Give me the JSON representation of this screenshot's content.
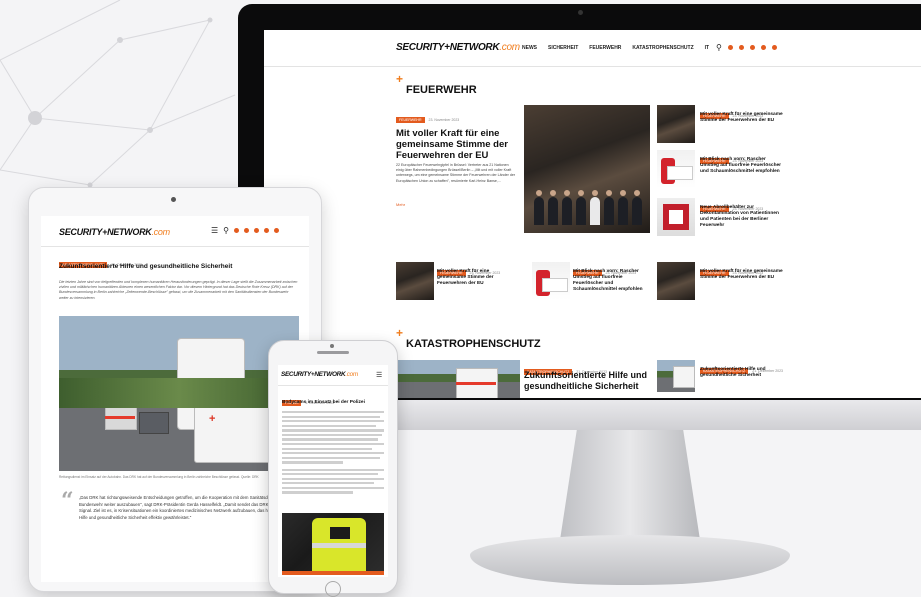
{
  "brand": {
    "logo_part1": "SECURITY",
    "logo_part2": "NETWORK",
    "logo_part3": ".com",
    "accent": "#e35b1e"
  },
  "desktop": {
    "nav": [
      "NEWS",
      "SICHERHEIT",
      "FEUERWEHR",
      "KATASTROPHENSCHUTZ",
      "IT"
    ],
    "feuerwehr": {
      "heading": "FEUERWEHR",
      "lead": {
        "category": "FEUERWEHR",
        "date": "23. November 2023",
        "title": "Mit voller Kraft für eine gemeinsame Stimme der Feuerwehren der EU",
        "text": "22 Europäischer Feuerwehrgipfel in Brüssel: Vertreter aus 21 Nationen einig über Rahmenbedingungen Brüssel/Berlin – „Mit und mit voller Kraft unterwegs, um eine gemeinsame Stimme der Feuerwehren der Länder der Europäischen Union zu schaffen\", resümierte Karl-Heinz Banse,...",
        "more": "Mehr"
      },
      "side": [
        {
          "category": "FEUERWEHR",
          "date": "23. November 2023",
          "title": "Mit voller Kraft für eine gemeinsame Stimme der Feuerwehren der EU"
        },
        {
          "category": "FEUERWEHR",
          "date": "23. November 2023",
          "title": "Mit Blick nach vorn: Rascher Umstieg auf fluorfreie Feuerlöscher und Schaumlöschmittel empfohlen"
        },
        {
          "category": "FEUERWEHR",
          "date": "23. November 2023",
          "title": "Neue Abrollbehälter zur Dekontamination von Patientinnen und Patienten bei der Berliner Feuerwehr"
        }
      ],
      "row": [
        {
          "category": "FEUERWEHR",
          "date": "23. November 2023",
          "title": "Mit voller Kraft für eine gemeinsame Stimme der Feuerwehren der EU"
        },
        {
          "category": "FEUERWEHR",
          "date": "23. November 2023",
          "title": "Mit Blick nach vorn: Rascher Umstieg auf fluorfreie Feuerlöscher und Schaumlöschmittel empfohlen"
        },
        {
          "category": "FEUERWEHR",
          "date": "23. November 2023",
          "title": "Mit voller Kraft für eine gemeinsame Stimme der Feuerwehren der EU"
        }
      ]
    },
    "katastrophenschutz": {
      "heading": "KATASTROPHENSCHUTZ",
      "lead": {
        "category": "KATASTROPHENSCHUTZ",
        "date": "21. Dezember 2023",
        "title": "Zukunftsorientierte Hilfe und gesundheitliche Sicherheit"
      },
      "side": {
        "category": "KATASTROPHENSCHUTZ",
        "date": "21. Dezember 2023",
        "title": "Zukunftsorientierte Hilfe und gesundheitliche Sicherheit"
      }
    }
  },
  "tablet": {
    "category": "KATASTROPHENSCHUTZ",
    "date": "21. Dezember 2023",
    "title": "Zukunftsorientierte Hilfe und gesundheitliche Sicherheit",
    "excerpt": "Die letzten Jahre sind von tiefgreifenden und komplexen humanitären Herausforderungen geprägt. In dieser Lage stellt die Zusammenarbeit zwischen zivilen und militärischen humanitären Akteuren einen wesentlichen Faktor dar. Vor diesem Hintergrund hat das Deutsche Rote Kreuz (DRK) auf der Bundesversammlung in Berlin zahlreiche „Zeitenwende-Beschlüsse\" gefasst, um die Zusammenarbeit mit den Sanitätsdiensten der Bundeswehr weiter zu intensivieren.",
    "caption": "Rettungsdienst im Einsatz auf der Autobahn. Das DRK hat auf der Bundesversammlung in Berlin zahlreiche Beschlüsse gefasst. Quelle: DRK",
    "quote": "„Das DRK hat richtungsweisende Entscheidungen getroffen, um die Kooperation mit dem Sanitätsdienst der Bundeswehr weiter auszubauen\", sagt DRK-Präsidentin Gerda Hasselfeldt. „Damit sendet das DRK ein starkes Signal. Ziel ist es, in Krisensituationen ein koordiniertes medizinisches Netzwerk aufzubauen, das humanitäre Hilfe und gesundheitliche Sicherheit effektiv gewährleistet.\""
  },
  "phone": {
    "category": "POLIZEI",
    "date": "4. Dezember 2023",
    "title": "Bodycams im Einsatz bei der Polizei"
  }
}
